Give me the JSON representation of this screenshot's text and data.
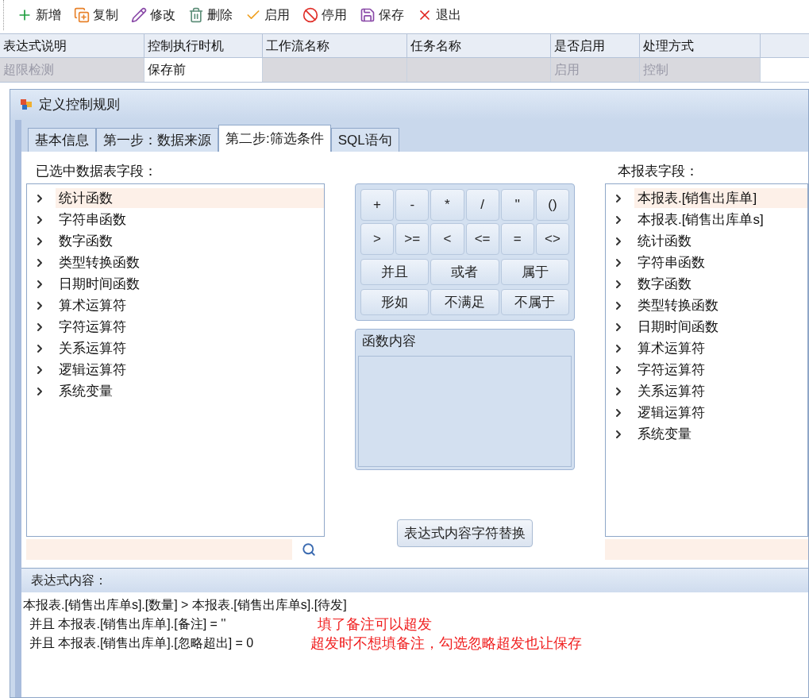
{
  "toolbar": [
    {
      "kind": "add",
      "label": "新增"
    },
    {
      "kind": "copy",
      "label": "复制"
    },
    {
      "kind": "edit",
      "label": "修改"
    },
    {
      "kind": "delete",
      "label": "删除"
    },
    {
      "kind": "enable",
      "label": "启用"
    },
    {
      "kind": "disable",
      "label": "停用"
    },
    {
      "kind": "save",
      "label": "保存"
    },
    {
      "kind": "exit",
      "label": "退出"
    }
  ],
  "table": {
    "columns": [
      "表达式说明",
      "控制执行时机",
      "工作流名称",
      "任务名称",
      "是否启用",
      "处理方式"
    ],
    "rows": [
      {
        "cells": [
          {
            "text": "超限检测",
            "disabled": true
          },
          {
            "text": "保存前",
            "disabled": false
          },
          {
            "text": "",
            "disabled": true
          },
          {
            "text": "",
            "disabled": true
          },
          {
            "text": "启用",
            "disabled": true
          },
          {
            "text": "控制",
            "disabled": true
          }
        ]
      }
    ]
  },
  "dialog": {
    "title": "定义控制规则",
    "tabs": [
      {
        "label": "基本信息",
        "selected": false
      },
      {
        "label": "第一步：数据来源",
        "selected": false
      },
      {
        "label": "第二步:筛选条件",
        "selected": true
      },
      {
        "label": "SQL语句",
        "selected": false
      }
    ],
    "left_panel": {
      "label": "已选中数据表字段：",
      "items": [
        {
          "label": "统计函数",
          "selected": true
        },
        {
          "label": "字符串函数",
          "selected": false
        },
        {
          "label": "数字函数",
          "selected": false
        },
        {
          "label": "类型转换函数",
          "selected": false
        },
        {
          "label": "日期时间函数",
          "selected": false
        },
        {
          "label": "算术运算符",
          "selected": false
        },
        {
          "label": "字符运算符",
          "selected": false
        },
        {
          "label": "关系运算符",
          "selected": false
        },
        {
          "label": "逻辑运算符",
          "selected": false
        },
        {
          "label": "系统变量",
          "selected": false
        }
      ]
    },
    "operators": [
      [
        "+",
        "-",
        "*",
        "/",
        "''",
        "()"
      ],
      [
        ">",
        ">=",
        "<",
        "<=",
        "=",
        "<>"
      ],
      [
        "并且",
        "或者",
        "属于"
      ],
      [
        "形如",
        "不满足",
        "不属于"
      ]
    ],
    "function_panel": {
      "title": "函数内容"
    },
    "replace_button": "表达式内容字符替换",
    "right_panel": {
      "label": "本报表字段：",
      "items": [
        {
          "label": "本报表.[销售出库单]",
          "selected": true
        },
        {
          "label": "本报表.[销售出库单s]",
          "selected": false
        },
        {
          "label": "统计函数",
          "selected": false
        },
        {
          "label": "字符串函数",
          "selected": false
        },
        {
          "label": "数字函数",
          "selected": false
        },
        {
          "label": "类型转换函数",
          "selected": false
        },
        {
          "label": "日期时间函数",
          "selected": false
        },
        {
          "label": "算术运算符",
          "selected": false
        },
        {
          "label": "字符运算符",
          "selected": false
        },
        {
          "label": "关系运算符",
          "selected": false
        },
        {
          "label": "逻辑运算符",
          "selected": false
        },
        {
          "label": "系统变量",
          "selected": false
        }
      ]
    },
    "expression": {
      "label": "表达式内容：",
      "lines": [
        "本报表.[销售出库单s].[数量] > 本报表.[销售出库单s].[待发]",
        "并且 本报表.[销售出库单].[备注] = ''",
        "并且 本报表.[销售出库单].[忽略超出] = 0"
      ],
      "annotations": [
        "填了备注可以超发",
        "超发时不想填备注，勾选忽略超发也让保存"
      ]
    }
  }
}
